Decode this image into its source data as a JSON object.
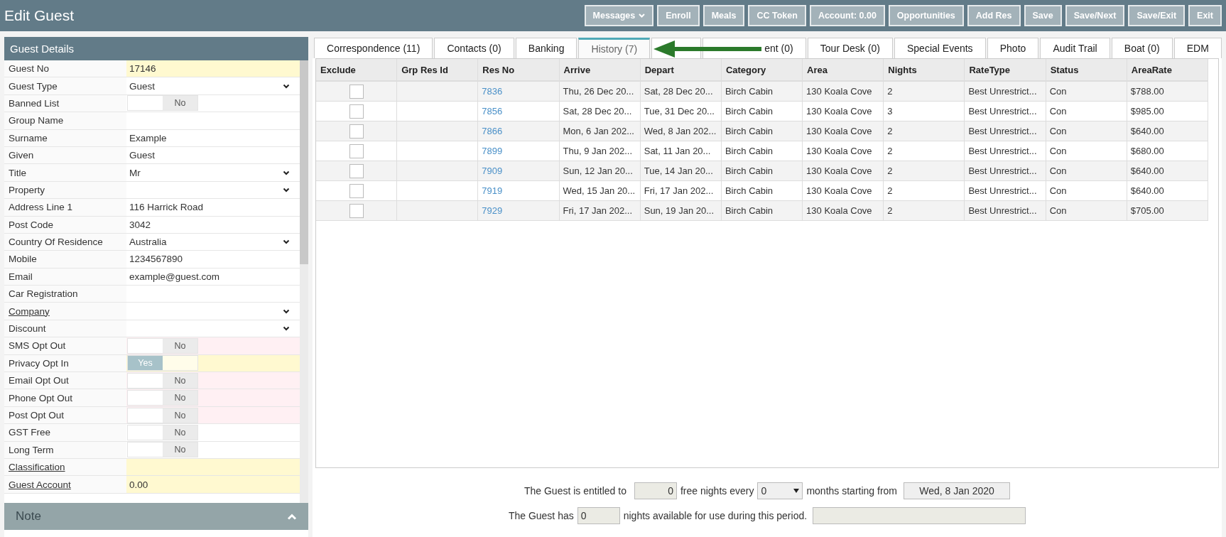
{
  "window": {
    "title": "Edit Guest"
  },
  "toolbar": [
    {
      "label": "Messages",
      "dropdown": true
    },
    {
      "label": "Enroll",
      "dropdown": false
    },
    {
      "label": "Meals",
      "dropdown": false
    },
    {
      "label": "CC Token",
      "dropdown": false
    },
    {
      "label": "Account: 0.00",
      "dropdown": false
    },
    {
      "label": "Opportunities",
      "dropdown": false
    },
    {
      "label": "Add Res",
      "dropdown": false
    },
    {
      "label": "Save",
      "dropdown": false
    },
    {
      "label": "Save/Next",
      "dropdown": false
    },
    {
      "label": "Save/Exit",
      "dropdown": false
    },
    {
      "label": "Exit",
      "dropdown": false
    }
  ],
  "guest_details": {
    "title": "Guest Details",
    "fields": [
      {
        "kind": "text",
        "label": "Guest No",
        "value": "17146",
        "color": "#fff9d0",
        "link": false
      },
      {
        "kind": "select",
        "label": "Guest Type",
        "value": "Guest",
        "link": false
      },
      {
        "kind": "toggle",
        "label": "Banned List",
        "on": false,
        "off_label": "No",
        "link": false
      },
      {
        "kind": "text",
        "label": "Group Name",
        "link": false
      },
      {
        "kind": "text",
        "label": "Surname",
        "value": "Example",
        "link": false
      },
      {
        "kind": "text",
        "label": "Given",
        "value": "Guest",
        "link": false
      },
      {
        "kind": "select",
        "label": "Title",
        "value": "Mr",
        "link": false
      },
      {
        "kind": "select",
        "label": "Property",
        "link": false
      },
      {
        "kind": "text",
        "label": "Address Line 1",
        "value": "116 Harrick Road",
        "link": false
      },
      {
        "kind": "text",
        "label": "Post Code",
        "value": "3042",
        "link": false
      },
      {
        "kind": "select",
        "label": "Country Of Residence",
        "value": "Australia",
        "link": false
      },
      {
        "kind": "text",
        "label": "Mobile",
        "value": "1234567890",
        "link": false
      },
      {
        "kind": "text",
        "label": "Email",
        "value": "example@guest.com",
        "link": false
      },
      {
        "kind": "text",
        "label": "Car Registration",
        "link": false
      },
      {
        "kind": "select",
        "label": "Company",
        "link": true
      },
      {
        "kind": "select",
        "label": "Discount",
        "link": false
      },
      {
        "kind": "toggle",
        "label": "SMS Opt Out",
        "on": false,
        "off_label": "No",
        "color": "#fff0f3",
        "link": false
      },
      {
        "kind": "toggle",
        "label": "Privacy Opt In",
        "on": true,
        "on_label": "Yes",
        "color": "#fff9d0",
        "link": false
      },
      {
        "kind": "toggle",
        "label": "Email Opt Out",
        "on": false,
        "off_label": "No",
        "color": "#fff0f3",
        "link": false
      },
      {
        "kind": "toggle",
        "label": "Phone Opt Out",
        "on": false,
        "off_label": "No",
        "color": "#fff0f3",
        "link": false
      },
      {
        "kind": "toggle",
        "label": "Post Opt Out",
        "on": false,
        "off_label": "No",
        "color": "#fff0f3",
        "link": false
      },
      {
        "kind": "toggle",
        "label": "GST Free",
        "on": false,
        "off_label": "No",
        "link": false
      },
      {
        "kind": "toggle",
        "label": "Long Term",
        "on": false,
        "off_label": "No",
        "link": false
      },
      {
        "kind": "text",
        "label": "Classification",
        "color": "#fff9d0",
        "link": true
      },
      {
        "kind": "text",
        "label": "Guest Account",
        "value": "0.00",
        "color": "#fff9d0",
        "link": true
      }
    ]
  },
  "note": {
    "title": "Note",
    "expanded": true
  },
  "tabs": [
    {
      "label": "Correspondence (11)",
      "selected": false
    },
    {
      "label": "Contacts (0)",
      "selected": false
    },
    {
      "label": "Banking",
      "selected": false
    },
    {
      "label": "History (7)",
      "selected": true
    },
    {
      "selected": false
    },
    {
      "label": "ent (0)",
      "selected": false
    },
    {
      "label": "Tour Desk (0)",
      "selected": false
    },
    {
      "label": "Special Events",
      "selected": false
    },
    {
      "label": "Photo",
      "selected": false
    },
    {
      "label": "Audit Trail",
      "selected": false
    },
    {
      "label": "Boat (0)",
      "selected": false
    },
    {
      "label": "EDM",
      "selected": false
    }
  ],
  "table": {
    "columns": [
      "Exclude",
      "Grp Res Id",
      "Res No",
      "Arrive",
      "Depart",
      "Category",
      "Area",
      "Nights",
      "RateType",
      "Status",
      "AreaRate"
    ],
    "rows": [
      {
        "exclude": false,
        "res_no": "7836",
        "arrive": "Thu, 26 Dec 20...",
        "depart": "Sat, 28 Dec 20...",
        "category": "Birch Cabin",
        "area": "130 Koala Cove",
        "nights": "2",
        "rate_type": "Best Unrestrict...",
        "status": "Con",
        "area_rate": "$788.00"
      },
      {
        "exclude": false,
        "res_no": "7856",
        "arrive": "Sat, 28 Dec 20...",
        "depart": "Tue, 31 Dec 20...",
        "category": "Birch Cabin",
        "area": "130 Koala Cove",
        "nights": "3",
        "rate_type": "Best Unrestrict...",
        "status": "Con",
        "area_rate": "$985.00"
      },
      {
        "exclude": false,
        "res_no": "7866",
        "arrive": "Mon, 6 Jan 202...",
        "depart": "Wed, 8 Jan 202...",
        "category": "Birch Cabin",
        "area": "130 Koala Cove",
        "nights": "2",
        "rate_type": "Best Unrestrict...",
        "status": "Con",
        "area_rate": "$640.00"
      },
      {
        "exclude": false,
        "res_no": "7899",
        "arrive": "Thu, 9 Jan 202...",
        "depart": "Sat, 11 Jan 20...",
        "category": "Birch Cabin",
        "area": "130 Koala Cove",
        "nights": "2",
        "rate_type": "Best Unrestrict...",
        "status": "Con",
        "area_rate": "$680.00"
      },
      {
        "exclude": false,
        "res_no": "7909",
        "arrive": "Sun, 12 Jan 20...",
        "depart": "Tue, 14 Jan 20...",
        "category": "Birch Cabin",
        "area": "130 Koala Cove",
        "nights": "2",
        "rate_type": "Best Unrestrict...",
        "status": "Con",
        "area_rate": "$640.00"
      },
      {
        "exclude": false,
        "res_no": "7919",
        "arrive": "Wed, 15 Jan 20...",
        "depart": "Fri, 17 Jan 202...",
        "category": "Birch Cabin",
        "area": "130 Koala Cove",
        "nights": "2",
        "rate_type": "Best Unrestrict...",
        "status": "Con",
        "area_rate": "$640.00"
      },
      {
        "exclude": false,
        "res_no": "7929",
        "arrive": "Fri, 17 Jan 202...",
        "depart": "Sun, 19 Jan 20...",
        "category": "Birch Cabin",
        "area": "130 Koala Cove",
        "nights": "2",
        "rate_type": "Best Unrestrict...",
        "status": "Con",
        "area_rate": "$705.00"
      }
    ]
  },
  "entitlement": {
    "text_1": "The Guest is entitled to",
    "free_nights": "0",
    "text_2": "free nights every",
    "months": "0",
    "text_3": "months starting from",
    "start_date": "Wed, 8 Jan 2020",
    "text_4": "The Guest has",
    "available": "0",
    "text_5": "nights available for use during this period."
  }
}
